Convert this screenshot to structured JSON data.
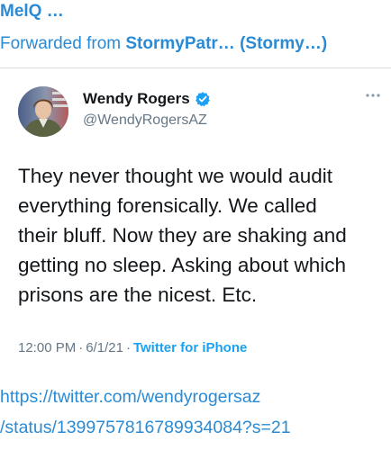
{
  "message": {
    "sender": "MelQ …",
    "forwarded_prefix": "Forwarded from ",
    "forwarded_name": "StormyPatr… (Stormy…)",
    "link_line1": "https://twitter.com/wendyrogersaz",
    "link_line2": "/status/1399757816789934084?s=21"
  },
  "tweet": {
    "display_name": "Wendy Rogers",
    "handle": "@WendyRogersAZ",
    "text_lines": [
      "They never thought we would audit",
      "everything forensically. We called",
      "their bluff. Now they are shaking and",
      "getting no sleep. Asking about which",
      "prisons are the nicest. Etc."
    ],
    "time": "12:00 PM",
    "date": "6/1/21",
    "source": "Twitter for iPhone",
    "separator": "·"
  },
  "icons": {
    "verified": "verified-badge-icon",
    "more": "more-options-icon"
  },
  "colors": {
    "telegram_link": "#2a8bd4",
    "twitter_blue": "#1da1f2",
    "text_dark": "#14171a",
    "text_gray": "#657786"
  }
}
